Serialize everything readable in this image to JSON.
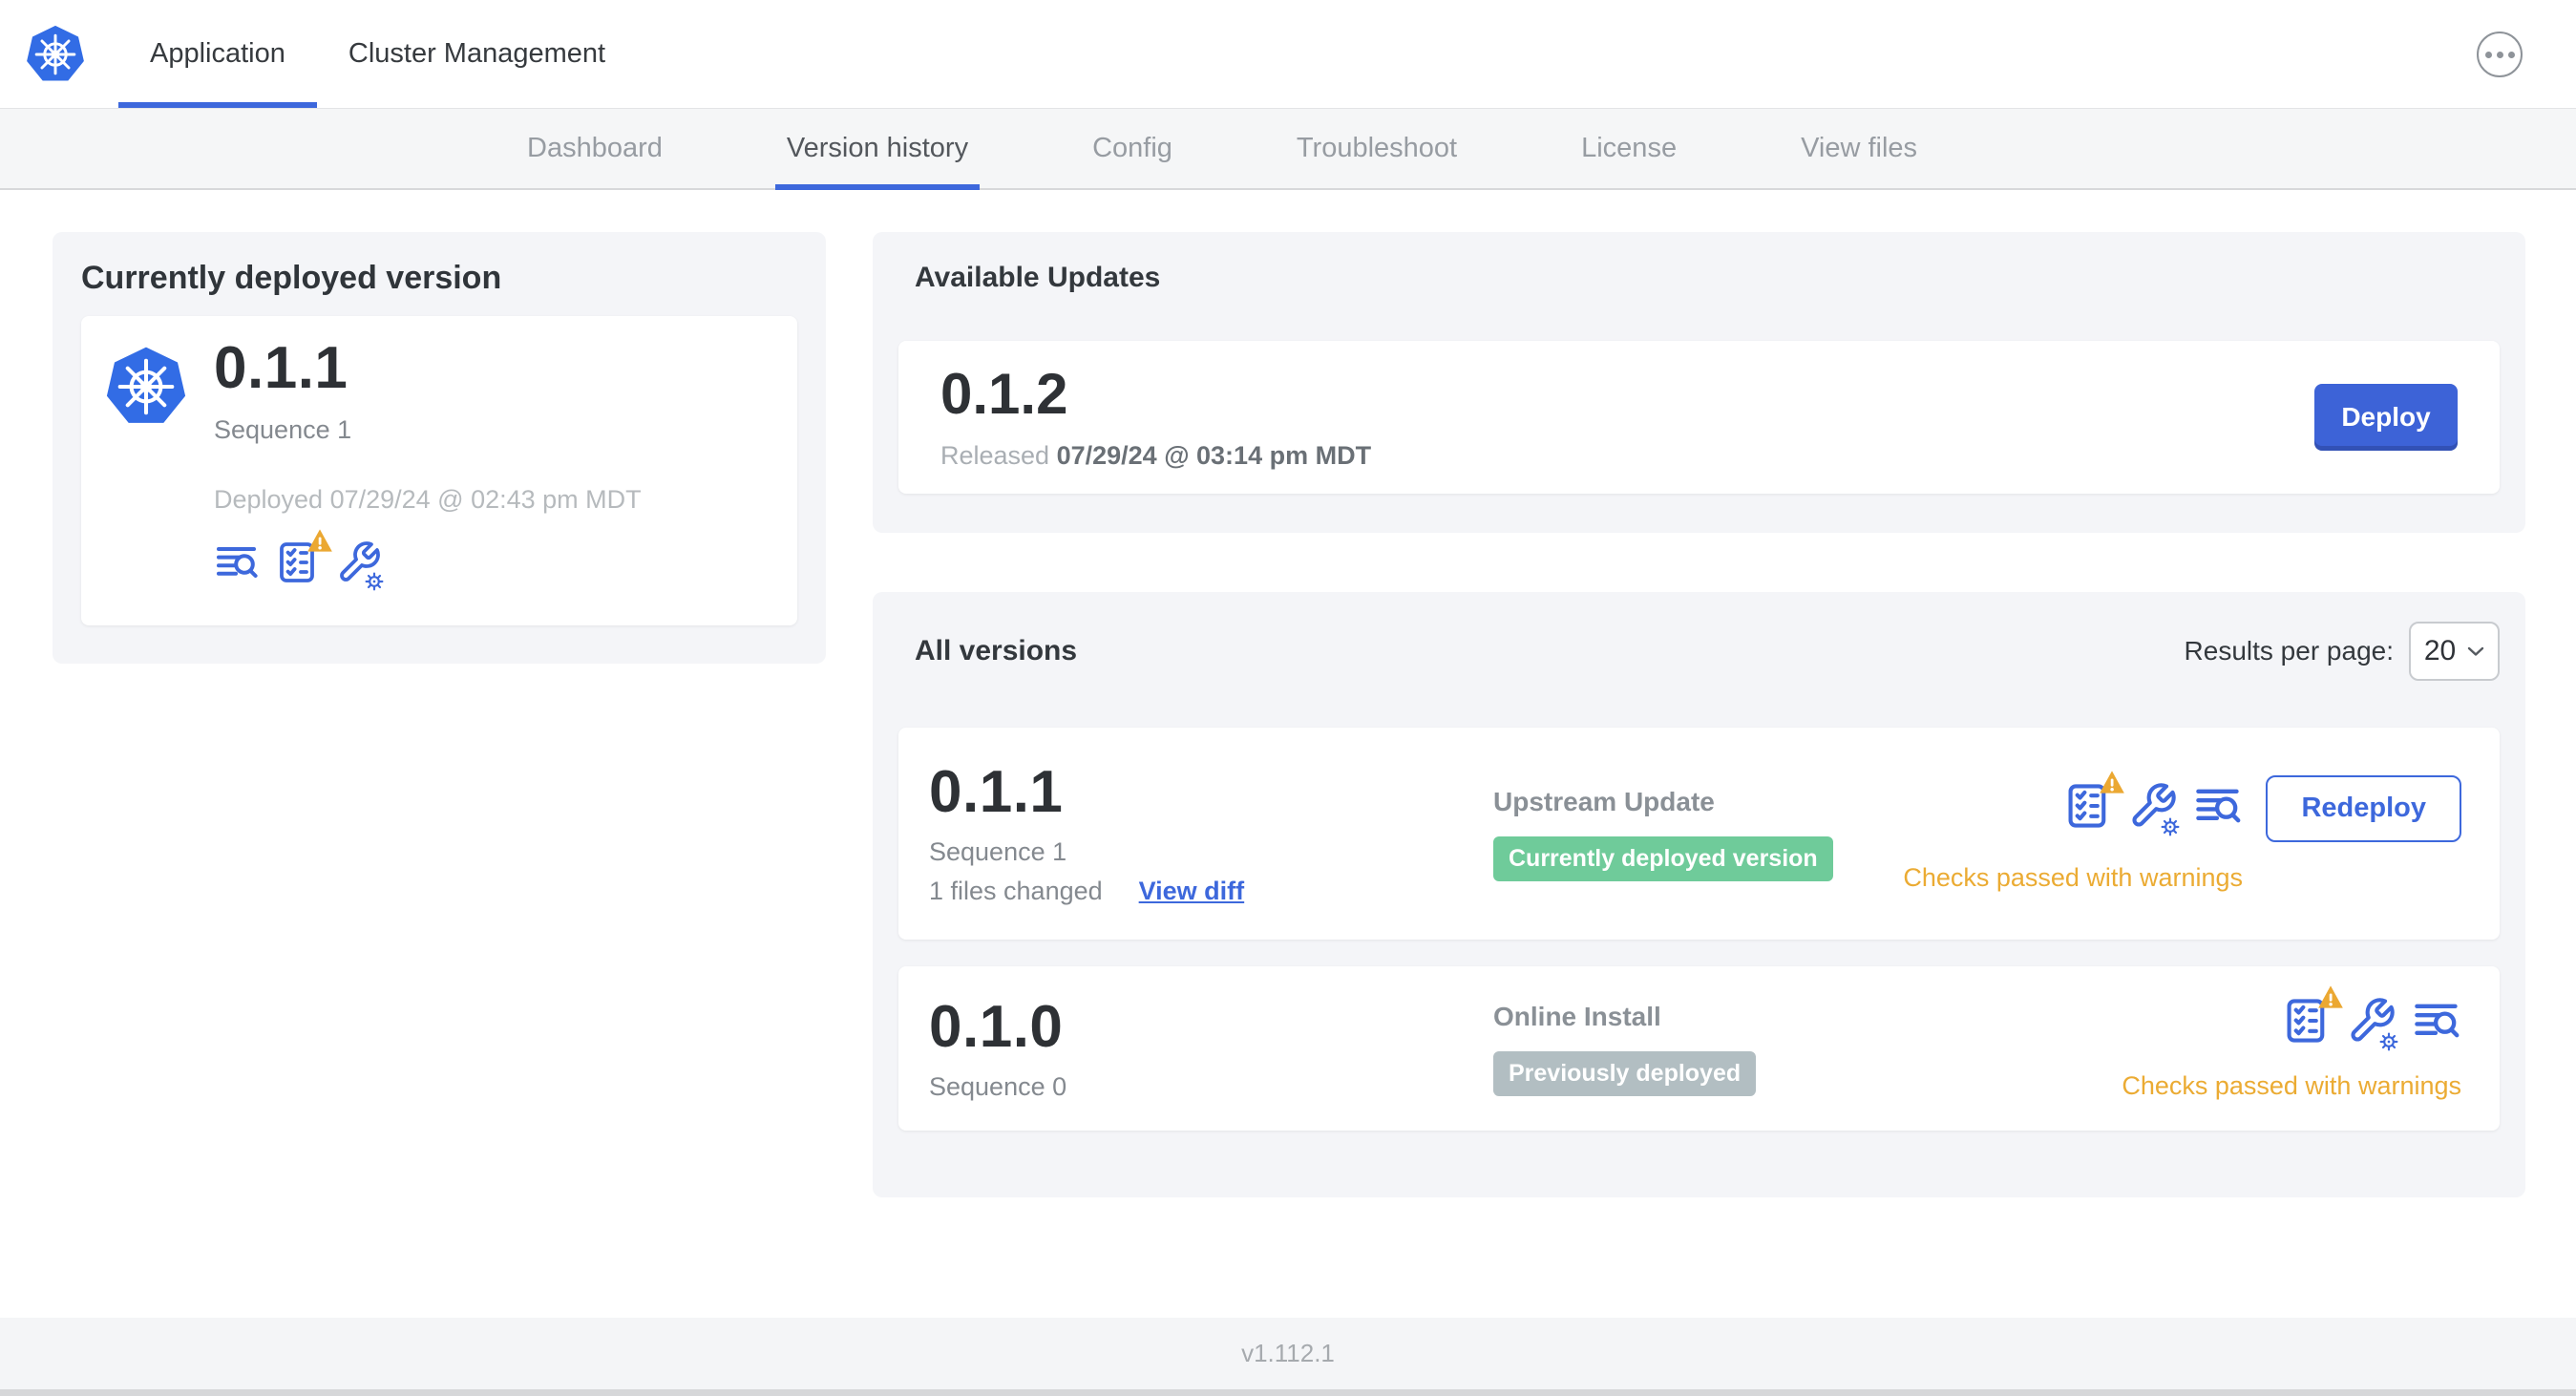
{
  "header": {
    "tabs": [
      {
        "label": "Application",
        "active": true
      },
      {
        "label": "Cluster Management",
        "active": false
      }
    ],
    "menu_icon": "ellipsis-menu-icon",
    "logo_icon": "kubernetes-logo"
  },
  "subnav": {
    "tabs": [
      {
        "label": "Dashboard",
        "active": false
      },
      {
        "label": "Version history",
        "active": true
      },
      {
        "label": "Config",
        "active": false
      },
      {
        "label": "Troubleshoot",
        "active": false
      },
      {
        "label": "License",
        "active": false
      },
      {
        "label": "View files",
        "active": false
      }
    ]
  },
  "current_version": {
    "title": "Currently deployed version",
    "version": "0.1.1",
    "sequence": "Sequence 1",
    "deployed": "Deployed 07/29/24 @ 02:43 pm MDT",
    "icons": [
      "deploy-logs-icon",
      "preflight-checks-warning-icon",
      "edit-config-icon"
    ]
  },
  "available_updates": {
    "title": "Available Updates",
    "version": "0.1.2",
    "released_prefix": "Released",
    "released_date": "07/29/24 @ 03:14 pm MDT",
    "deploy_label": "Deploy"
  },
  "all_versions": {
    "title": "All versions",
    "results_per_page_label": "Results per page:",
    "results_per_page_value": "20",
    "rows": [
      {
        "version": "0.1.1",
        "sequence": "Sequence 1",
        "files_changed": "1 files changed",
        "view_diff_label": "View diff",
        "source": "Upstream Update",
        "badge_label": "Currently deployed version",
        "badge_color": "#6fcb9a",
        "status": "Checks passed with warnings",
        "action_label": "Redeploy",
        "icons": [
          "preflight-checks-warning-icon",
          "edit-config-icon",
          "deploy-logs-icon"
        ]
      },
      {
        "version": "0.1.0",
        "sequence": "Sequence 0",
        "source": "Online Install",
        "badge_label": "Previously deployed",
        "badge_color": "#b2bec2",
        "status": "Checks passed with warnings",
        "icons": [
          "preflight-checks-warning-icon",
          "edit-config-icon",
          "deploy-logs-icon"
        ]
      }
    ]
  },
  "footer": {
    "app_version": "v1.112.1"
  },
  "colors": {
    "accent_blue": "#3d68dc",
    "button_blue": "#3d63d7",
    "k8s_blue": "#326ce5",
    "warning_amber": "#ebab33",
    "badge_green": "#6fcb9a",
    "badge_gray": "#b2bec2",
    "card_gray": "#f4f5f8"
  }
}
